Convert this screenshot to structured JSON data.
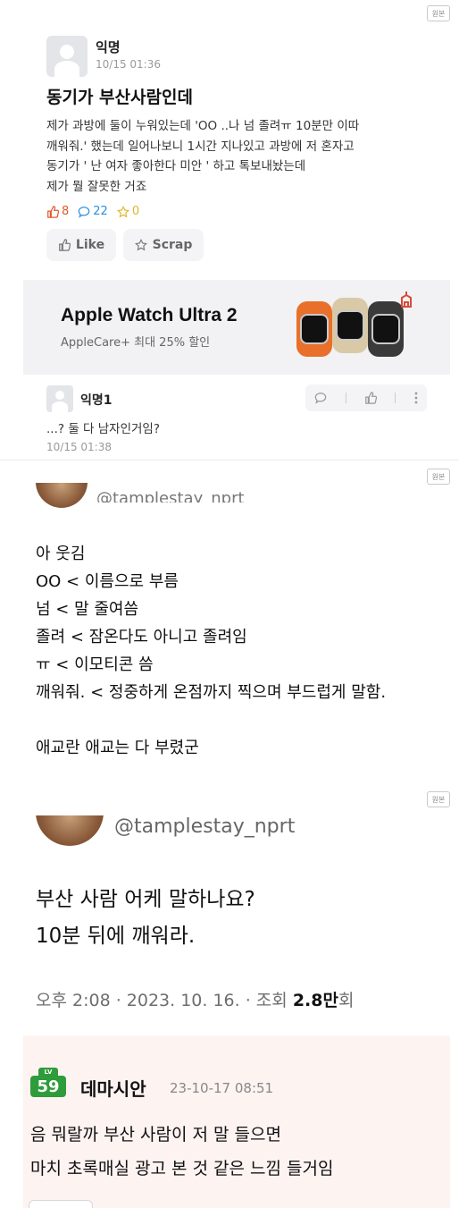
{
  "post": {
    "author": "익명",
    "date": "10/15 01:36",
    "title": "동기가 부산사람인데",
    "body_lines": [
      "제가 과방에 둘이 누워있는데 'OO ..나 넘 졸려ㅠ 10분만 이따",
      "깨워줘.' 했는데 일어나보니 1시간 지나있고 과방에 저 혼자고",
      "동기가 ' 난 여자 좋아한다 미안 ' 하고 톡보내놨는데",
      "제가 뭘 잘못한 거죠"
    ],
    "like_count": "8",
    "comment_count": "22",
    "scrap_count": "0",
    "like_label": "Like",
    "scrap_label": "Scrap",
    "original_badge": "원본"
  },
  "ad": {
    "title": "Apple Watch Ultra 2",
    "subtitle": "AppleCare+ 최대 25% 할인"
  },
  "comment": {
    "author": "익명1",
    "text": "...? 둘 다 남자인거임?",
    "date": "10/15 01:38"
  },
  "tweet1": {
    "handle": "@tamplestay_nprt",
    "lines": [
      "아 웃김",
      "OO < 이름으로 부름",
      "넘 < 말 줄여씀",
      "졸려 < 잠온다도 아니고 졸려임",
      "ㅠ < 이모티콘 씀",
      "깨워줘. < 정중하게 온점까지 찍으며 부드럽게 말함.",
      "",
      "애교란 애교는 다 부렸군"
    ],
    "original_badge": "원본"
  },
  "tweet2": {
    "handle": "@tamplestay_nprt",
    "lines": [
      "부산 사람 어케 말하나요?",
      "10분 뒤에 깨워라."
    ],
    "meta_prefix": "오후 2:08 · 2023. 10. 16. · 조회 ",
    "views_num": "2.8만",
    "views_suffix": "회",
    "original_badge": "원본"
  },
  "comment2": {
    "level_top": "LV",
    "level": "59",
    "author": "데마시안",
    "date": "23-10-17 08:51",
    "lines": [
      "음 뭐랄까 부산 사람이 저 말 들으면",
      "마치 초록매실 광고 본 것 같은 느낌 들거임"
    ]
  },
  "colors": {
    "like": "#e05a2b",
    "comment": "#2b8fe0",
    "scrap": "#e0b52b",
    "ad_bg": "#f2f2f4",
    "comment2_bg": "#fdf3f1",
    "level_badge": "#2e9c3a"
  }
}
